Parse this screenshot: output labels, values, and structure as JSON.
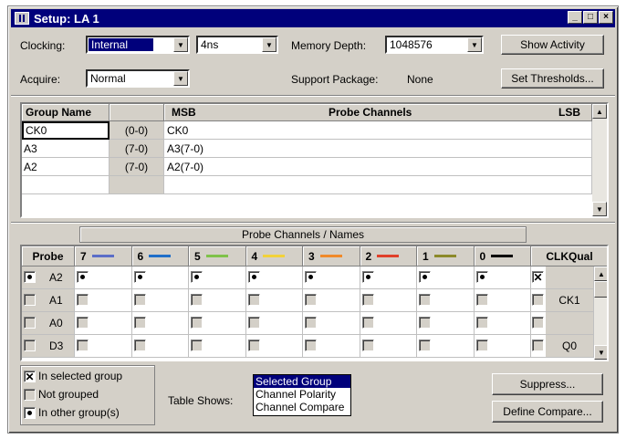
{
  "window": {
    "title": "Setup: LA 1"
  },
  "titlebar_buttons": {
    "minimize": "_",
    "maximize": "□",
    "close": "×"
  },
  "controls": {
    "clocking_label": "Clocking:",
    "clocking_value": "Internal",
    "clock_period_value": "4ns",
    "memory_depth_label": "Memory Depth:",
    "memory_depth_value": "1048576",
    "show_activity": "Show Activity",
    "acquire_label": "Acquire:",
    "acquire_value": "Normal",
    "support_package_label": "Support Package:",
    "support_package_value": "None",
    "set_thresholds": "Set Thresholds..."
  },
  "groups_table": {
    "headers": {
      "group_name": "Group Name",
      "msb": "MSB",
      "probe_channels": "Probe Channels",
      "lsb": "LSB"
    },
    "rows": [
      {
        "name": "CK0",
        "range": "(0-0)",
        "channels": "CK0"
      },
      {
        "name": "A3",
        "range": "(7-0)",
        "channels": "A3(7-0)"
      },
      {
        "name": "A2",
        "range": "(7-0)",
        "channels": "A2(7-0)"
      }
    ]
  },
  "probe_table": {
    "banner": "Probe Channels / Names",
    "probe_header": "Probe",
    "clkqual_header": "CLKQual",
    "channels": [
      {
        "label": "7",
        "color": "#5b6ec8"
      },
      {
        "label": "6",
        "color": "#1f6fc9"
      },
      {
        "label": "5",
        "color": "#7fc24a"
      },
      {
        "label": "4",
        "color": "#f2d23a"
      },
      {
        "label": "3",
        "color": "#f08a2a"
      },
      {
        "label": "2",
        "color": "#e0402a"
      },
      {
        "label": "1",
        "color": "#8c8a2a"
      },
      {
        "label": "0",
        "color": "#000000"
      }
    ],
    "rows": [
      {
        "probe": "A2",
        "state": "other",
        "cells": [
          "other",
          "other",
          "other",
          "other",
          "other",
          "other",
          "other",
          "other"
        ],
        "clk_state": "selected",
        "clkqual": ""
      },
      {
        "probe": "A1",
        "state": "none",
        "cells": [
          "none",
          "none",
          "none",
          "none",
          "none",
          "none",
          "none",
          "none"
        ],
        "clk_state": "none",
        "clkqual": "CK1"
      },
      {
        "probe": "A0",
        "state": "none",
        "cells": [
          "none",
          "none",
          "none",
          "none",
          "none",
          "none",
          "none",
          "none"
        ],
        "clk_state": "none",
        "clkqual": ""
      },
      {
        "probe": "D3",
        "state": "none",
        "cells": [
          "none",
          "none",
          "none",
          "none",
          "none",
          "none",
          "none",
          "none"
        ],
        "clk_state": "none",
        "clkqual": "Q0"
      }
    ]
  },
  "legend": {
    "in_selected_group": "In selected group",
    "not_grouped": "Not grouped",
    "in_other_groups": "In other group(s)"
  },
  "table_shows": {
    "label": "Table Shows:",
    "options": [
      "Selected Group",
      "Channel Polarity",
      "Channel Compare"
    ],
    "selected": "Selected Group"
  },
  "buttons": {
    "suppress": "Suppress...",
    "define_compare": "Define Compare..."
  },
  "colors": {
    "titlebar": "#00007b",
    "face": "#d4d0c8",
    "selection": "#00007b"
  }
}
